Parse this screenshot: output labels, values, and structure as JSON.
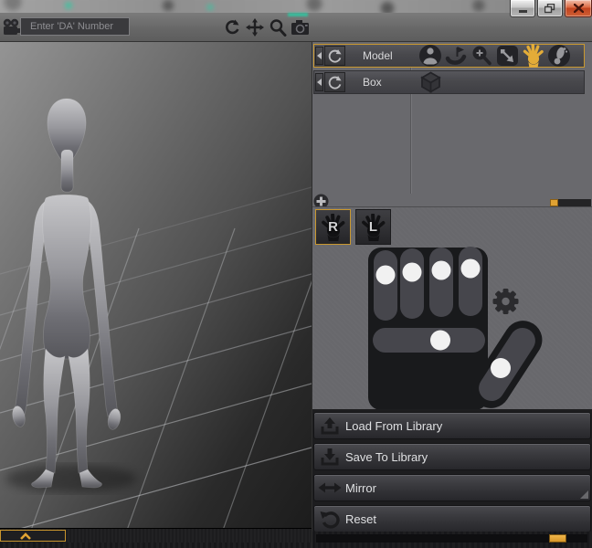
{
  "window": {
    "app": "3D doll posing tool",
    "controls": [
      {
        "name": "minimize"
      },
      {
        "name": "restore"
      },
      {
        "name": "close",
        "color": "#C2431F"
      }
    ]
  },
  "toolbar": {
    "da_input": {
      "value": "",
      "placeholder": "Enter 'DA' Number"
    },
    "icons": [
      "film-camera",
      "rotate-view",
      "pan-view",
      "zoom-view",
      "screenshot-camera"
    ]
  },
  "scene_list": {
    "rows": [
      {
        "label": "Model",
        "selected": true,
        "tool_icons": [
          "figure",
          "pose-pin",
          "zoom-plus",
          "transform-arrow",
          "hand",
          "foot"
        ],
        "hand_icon_active": true
      },
      {
        "label": "Box",
        "selected": false,
        "tool_icons": [
          "cube"
        ]
      }
    ],
    "add_button": "plus",
    "scrollbar": {
      "thumb_position": "left"
    }
  },
  "hand_editor": {
    "tabs": [
      {
        "label": "R",
        "selected": true
      },
      {
        "label": "L",
        "selected": false
      }
    ],
    "finger_sliders": [
      {
        "name": "index",
        "value": 0.33
      },
      {
        "name": "middle",
        "value": 0.3
      },
      {
        "name": "ring",
        "value": 0.28
      },
      {
        "name": "pinky",
        "value": 0.25
      }
    ],
    "spread_slider": {
      "value": 0.55
    },
    "thumb_slider": {
      "value": 0.6
    },
    "gear": "settings"
  },
  "actions": [
    {
      "label": "Load From Library",
      "icon": "upload-tray"
    },
    {
      "label": "Save To Library",
      "icon": "download-tray"
    },
    {
      "label": "Mirror",
      "icon": "mirror-arrows",
      "has_resize_grip": true
    },
    {
      "label": "Reset",
      "icon": "undo-arrow"
    }
  ],
  "viewport": {
    "content": "gray mannequin figure standing on perspective grid floor",
    "expander": "collapse-up"
  },
  "colors": {
    "accent_orange": "#E0A233",
    "selection_border": "#C9982F",
    "teal_dot": "#2EC9A2",
    "hand_black": "#1A1A1C",
    "track_gray": "#46464C",
    "knob_white": "#F1F1F1",
    "close_red": "#C2431F",
    "panel_gray": "#69696D"
  }
}
